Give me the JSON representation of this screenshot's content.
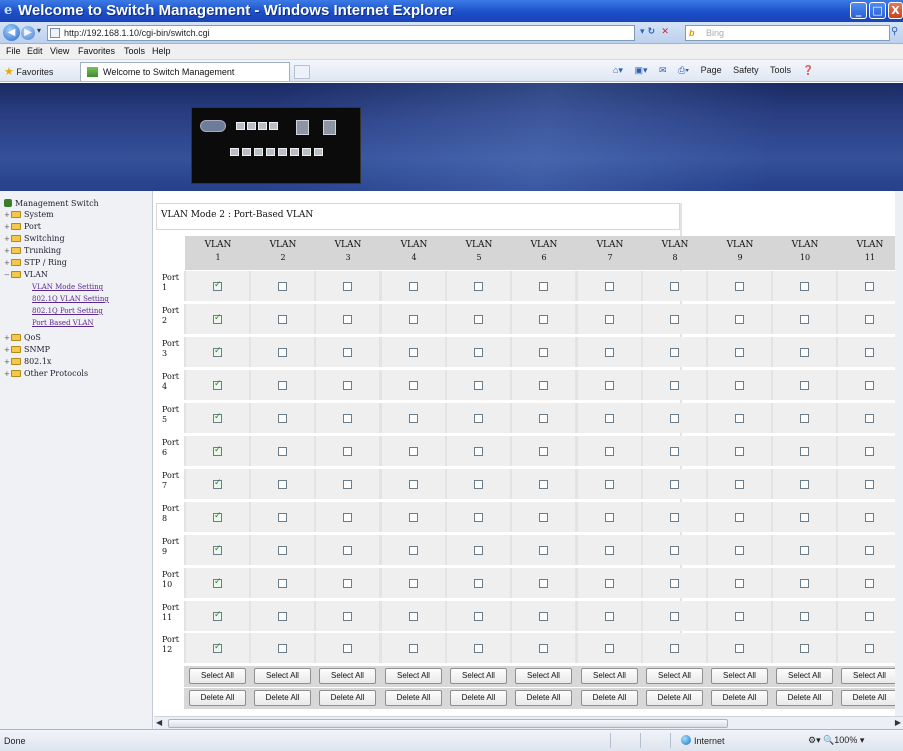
{
  "window": {
    "title": "Welcome to Switch Management - Windows Internet Explorer",
    "min": "_",
    "max": "□",
    "close": "X"
  },
  "address": {
    "url": "http://192.168.1.10/cgi-bin/switch.cgi",
    "search_placeholder": "Bing",
    "search_brand": "Bing"
  },
  "menu": [
    "File",
    "Edit",
    "View",
    "Favorites",
    "Tools",
    "Help"
  ],
  "favorites_bar": {
    "favorites_label": "Favorites",
    "tab_title": "Welcome to Switch Management"
  },
  "command_bar": [
    "Page",
    "Safety",
    "Tools"
  ],
  "sidebar": {
    "root": "Management Switch",
    "items": [
      "System",
      "Port",
      "Switching",
      "Trunking",
      "STP / Ring",
      "VLAN",
      "QoS",
      "SNMP",
      "802.1x",
      "Other Protocols"
    ],
    "vlan_children": [
      "VLAN Mode Setting",
      "802.1Q VLAN Setting",
      "802.1Q Port Setting",
      "Port Based VLAN"
    ]
  },
  "main": {
    "mode_title": "VLAN Mode 2 : Port-Based VLAN",
    "vlan_label": "VLAN",
    "vlans": [
      "1",
      "2",
      "3",
      "4",
      "5",
      "6",
      "7",
      "8",
      "9",
      "10",
      "11"
    ],
    "port_label": "Port",
    "ports": [
      "1",
      "2",
      "3",
      "4",
      "5",
      "6",
      "7",
      "8",
      "9",
      "10",
      "11",
      "12"
    ],
    "membership_checked_vlan": "1",
    "select_all": "Select All",
    "delete_all": "Delete All"
  },
  "status": {
    "text": "Done",
    "zone": "Internet",
    "zoom": "100%"
  },
  "colors": {
    "title_bar": "#1c4fc9",
    "banner": "#2a3e82",
    "header_cell": "#d6d6d6",
    "check": "#2e8a2e"
  }
}
